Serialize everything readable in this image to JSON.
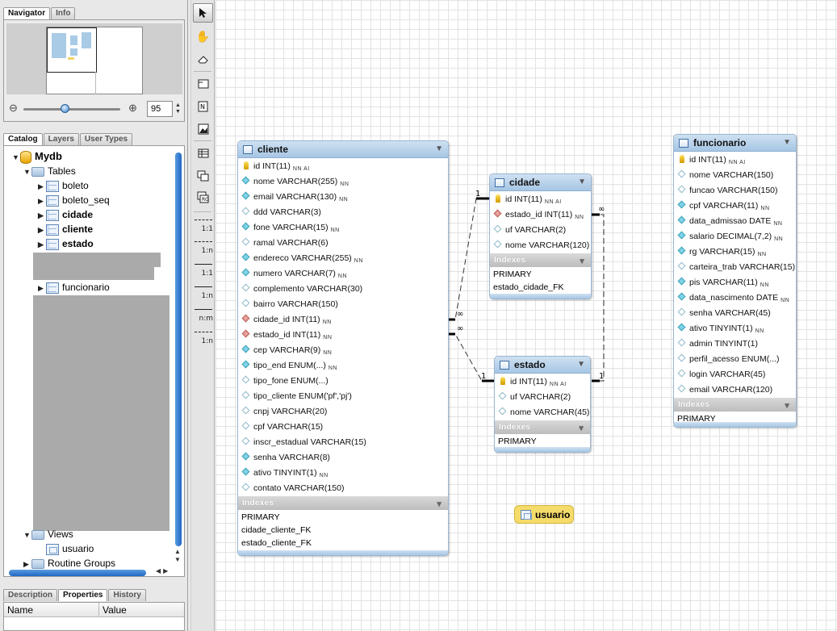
{
  "navigator": {
    "tabs": [
      "Navigator",
      "Info"
    ],
    "zoom_value": "95",
    "zoom_out_icon": "zoom-out-icon",
    "zoom_in_icon": "zoom-in-icon"
  },
  "catalog": {
    "tabs": [
      "Catalog",
      "Layers",
      "User Types"
    ],
    "schema": "Mydb",
    "tables_folder": "Tables",
    "tables": [
      "boleto",
      "boleto_seq",
      "cidade",
      "cliente",
      "estado",
      "funcionario"
    ],
    "views_folder": "Views",
    "views": [
      "usuario"
    ],
    "routines_folder": "Routine Groups"
  },
  "properties": {
    "tabs": [
      "Description",
      "Properties",
      "History"
    ],
    "col_name": "Name",
    "col_value": "Value"
  },
  "toolbar": {
    "relations": [
      "1:1",
      "1:n",
      "1:1",
      "1:n",
      "n:m",
      "1:n"
    ]
  },
  "cardinality": {
    "one": "1",
    "many": "∞"
  },
  "entities": {
    "cliente": {
      "title": "cliente",
      "columns": [
        {
          "name": "id INT(11)",
          "flags": "NN AI",
          "kind": "pk"
        },
        {
          "name": "nome VARCHAR(255)",
          "flags": "NN",
          "kind": "nn"
        },
        {
          "name": "email VARCHAR(130)",
          "flags": "NN",
          "kind": "nn"
        },
        {
          "name": "ddd VARCHAR(3)",
          "flags": "",
          "kind": "null"
        },
        {
          "name": "fone VARCHAR(15)",
          "flags": "NN",
          "kind": "nn"
        },
        {
          "name": "ramal VARCHAR(6)",
          "flags": "",
          "kind": "null"
        },
        {
          "name": "endereco VARCHAR(255)",
          "flags": "NN",
          "kind": "nn"
        },
        {
          "name": "numero VARCHAR(7)",
          "flags": "NN",
          "kind": "nn"
        },
        {
          "name": "complemento VARCHAR(30)",
          "flags": "",
          "kind": "null"
        },
        {
          "name": "bairro VARCHAR(150)",
          "flags": "",
          "kind": "null"
        },
        {
          "name": "cidade_id INT(11)",
          "flags": "NN",
          "kind": "fk"
        },
        {
          "name": "estado_id INT(11)",
          "flags": "NN",
          "kind": "fk"
        },
        {
          "name": "cep VARCHAR(9)",
          "flags": "NN",
          "kind": "nn"
        },
        {
          "name": "tipo_end ENUM(...)",
          "flags": "NN",
          "kind": "nn"
        },
        {
          "name": "tipo_fone ENUM(...)",
          "flags": "",
          "kind": "null"
        },
        {
          "name": "tipo_cliente ENUM('pf','pj')",
          "flags": "",
          "kind": "null"
        },
        {
          "name": "cnpj VARCHAR(20)",
          "flags": "",
          "kind": "null"
        },
        {
          "name": "cpf VARCHAR(15)",
          "flags": "",
          "kind": "null"
        },
        {
          "name": "inscr_estadual VARCHAR(15)",
          "flags": "",
          "kind": "null"
        },
        {
          "name": "senha VARCHAR(8)",
          "flags": "",
          "kind": "nn"
        },
        {
          "name": "ativo TINYINT(1)",
          "flags": "NN",
          "kind": "nn"
        },
        {
          "name": "contato VARCHAR(150)",
          "flags": "",
          "kind": "null"
        }
      ],
      "indexes_label": "Indexes",
      "indexes": [
        "PRIMARY",
        "cidade_cliente_FK",
        "estado_cliente_FK"
      ]
    },
    "cidade": {
      "title": "cidade",
      "columns": [
        {
          "name": "id INT(11)",
          "flags": "NN AI",
          "kind": "pk"
        },
        {
          "name": "estado_id INT(11)",
          "flags": "NN",
          "kind": "fk"
        },
        {
          "name": "uf VARCHAR(2)",
          "flags": "",
          "kind": "null"
        },
        {
          "name": "nome VARCHAR(120)",
          "flags": "",
          "kind": "null"
        }
      ],
      "indexes_label": "Indexes",
      "indexes": [
        "PRIMARY",
        "estado_cidade_FK"
      ]
    },
    "estado": {
      "title": "estado",
      "columns": [
        {
          "name": "id INT(11)",
          "flags": "NN AI",
          "kind": "pk"
        },
        {
          "name": "uf VARCHAR(2)",
          "flags": "",
          "kind": "null"
        },
        {
          "name": "nome VARCHAR(45)",
          "flags": "",
          "kind": "null"
        }
      ],
      "indexes_label": "Indexes",
      "indexes": [
        "PRIMARY"
      ]
    },
    "funcionario": {
      "title": "funcionario",
      "columns": [
        {
          "name": "id INT(11)",
          "flags": "NN AI",
          "kind": "pk"
        },
        {
          "name": "nome VARCHAR(150)",
          "flags": "",
          "kind": "null"
        },
        {
          "name": "funcao VARCHAR(150)",
          "flags": "",
          "kind": "null"
        },
        {
          "name": "cpf VARCHAR(11)",
          "flags": "NN",
          "kind": "nn"
        },
        {
          "name": "data_admissao DATE",
          "flags": "NN",
          "kind": "nn"
        },
        {
          "name": "salario DECIMAL(7,2)",
          "flags": "NN",
          "kind": "nn"
        },
        {
          "name": "rg VARCHAR(15)",
          "flags": "NN",
          "kind": "nn"
        },
        {
          "name": "carteira_trab VARCHAR(15)",
          "flags": "",
          "kind": "null"
        },
        {
          "name": "pis VARCHAR(11)",
          "flags": "NN",
          "kind": "nn"
        },
        {
          "name": "data_nascimento DATE",
          "flags": "NN",
          "kind": "nn"
        },
        {
          "name": "senha VARCHAR(45)",
          "flags": "",
          "kind": "null"
        },
        {
          "name": "ativo TINYINT(1)",
          "flags": "NN",
          "kind": "nn"
        },
        {
          "name": "admin TINYINT(1)",
          "flags": "",
          "kind": "null"
        },
        {
          "name": "perfil_acesso ENUM(...)",
          "flags": "",
          "kind": "null"
        },
        {
          "name": "login VARCHAR(45)",
          "flags": "",
          "kind": "null"
        },
        {
          "name": "email VARCHAR(120)",
          "flags": "",
          "kind": "null"
        }
      ],
      "indexes_label": "Indexes",
      "indexes": [
        "PRIMARY"
      ]
    }
  },
  "view_box": {
    "title": "usuario"
  }
}
